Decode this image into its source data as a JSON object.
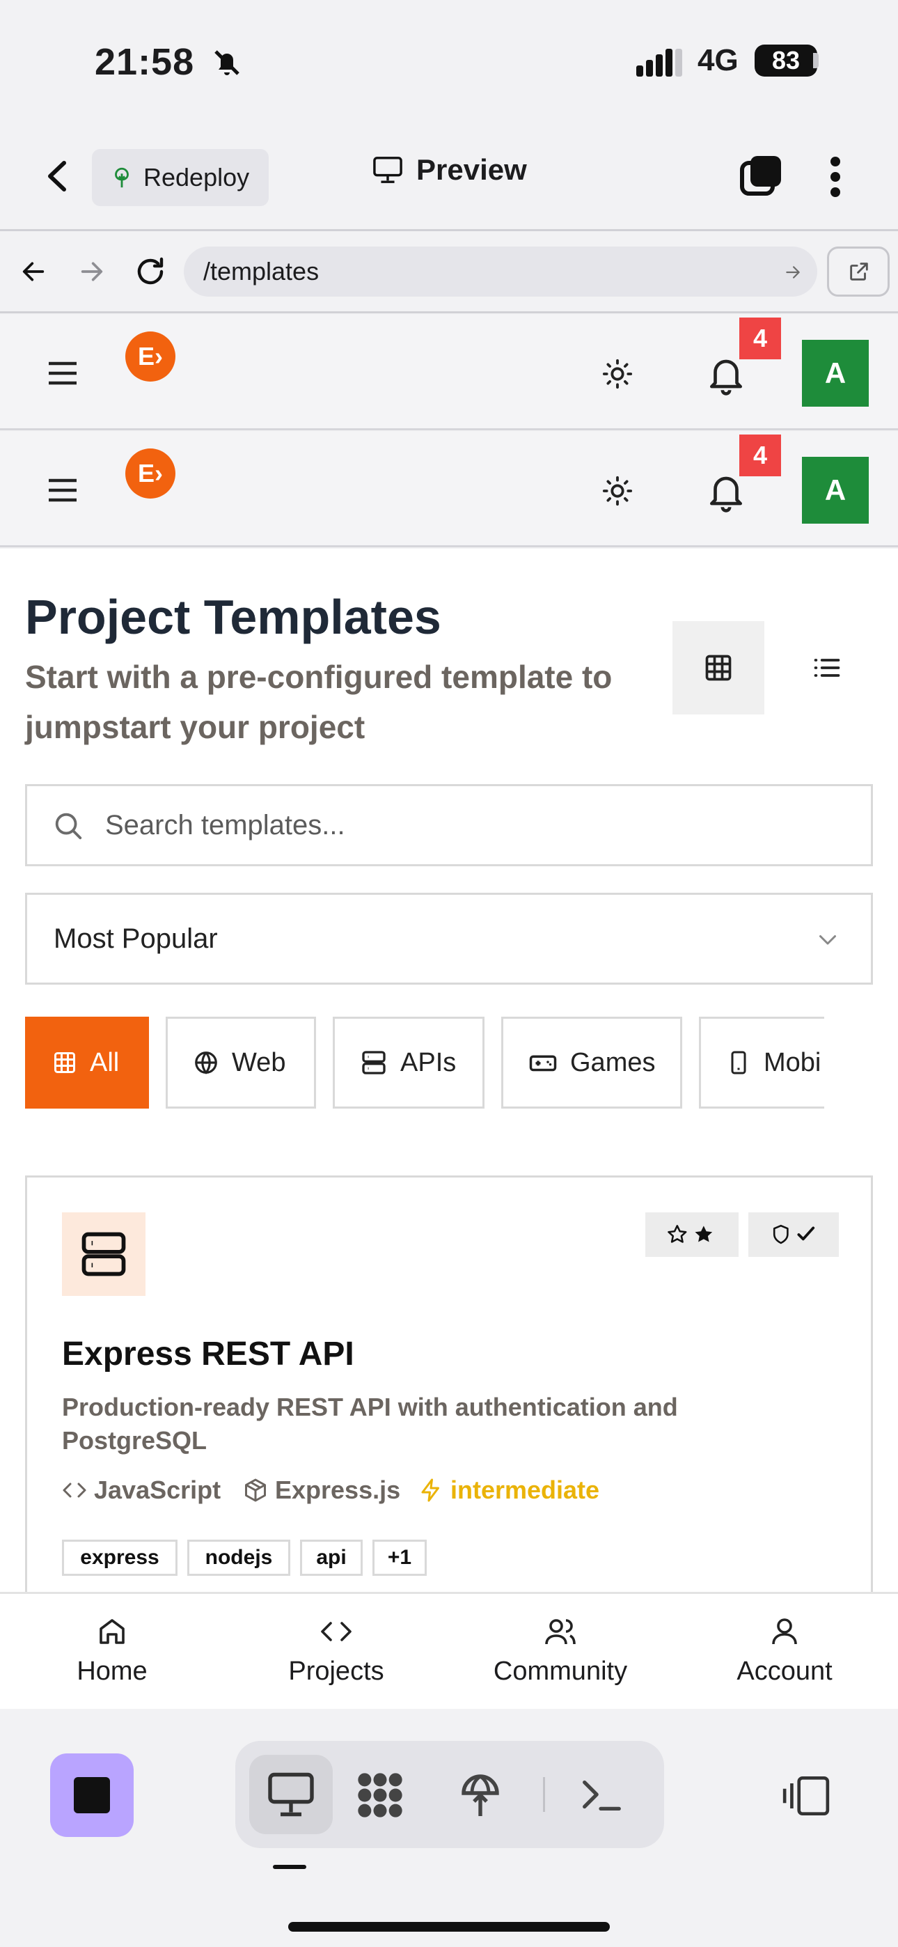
{
  "status_bar": {
    "time": "21:58",
    "network": "4G",
    "battery": "83"
  },
  "app_header": {
    "redeploy_label": "Redeploy",
    "preview_label": "Preview"
  },
  "browser": {
    "url": "/templates"
  },
  "site_nav": {
    "notification_count": "4",
    "avatar_initial": "A"
  },
  "page": {
    "title": "Project Templates",
    "subtitle": "Start with a pre-configured template to jumpstart your project",
    "search_placeholder": "Search templates...",
    "sort_value": "Most Popular",
    "categories": [
      "All",
      "Web",
      "APIs",
      "Games",
      "Mobi"
    ],
    "active_category": "All"
  },
  "template_card": {
    "title": "Express REST API",
    "description": "Production-ready REST API with authentication and PostgreSQL",
    "language": "JavaScript",
    "framework": "Express.js",
    "difficulty": "intermediate",
    "tags": [
      "express",
      "nodejs",
      "api",
      "+1"
    ]
  },
  "bottom_nav": {
    "items": [
      "Home",
      "Projects",
      "Community",
      "Account"
    ]
  },
  "colors": {
    "brand": "#f2620f",
    "badge": "#ef4444",
    "avatar": "#1e8c3a",
    "difficulty": "#eab308",
    "stop_button": "#b9a4ff"
  },
  "icons": [
    "back-chevron-icon",
    "tree-icon",
    "monitor-icon",
    "tabs-icon",
    "more-vertical-icon",
    "arrow-left-icon",
    "arrow-right-icon",
    "reload-icon",
    "external-link-icon",
    "menu-icon",
    "sun-icon",
    "bell-icon",
    "grid-icon",
    "list-icon",
    "search-icon",
    "chevron-down-icon",
    "globe-icon",
    "server-icon",
    "gamepad-icon",
    "phone-icon",
    "star-icon",
    "shield-check-icon",
    "code-icon",
    "package-icon",
    "zap-icon",
    "home-icon",
    "user-icon",
    "users-icon",
    "terminal-icon",
    "sidebar-icon"
  ]
}
